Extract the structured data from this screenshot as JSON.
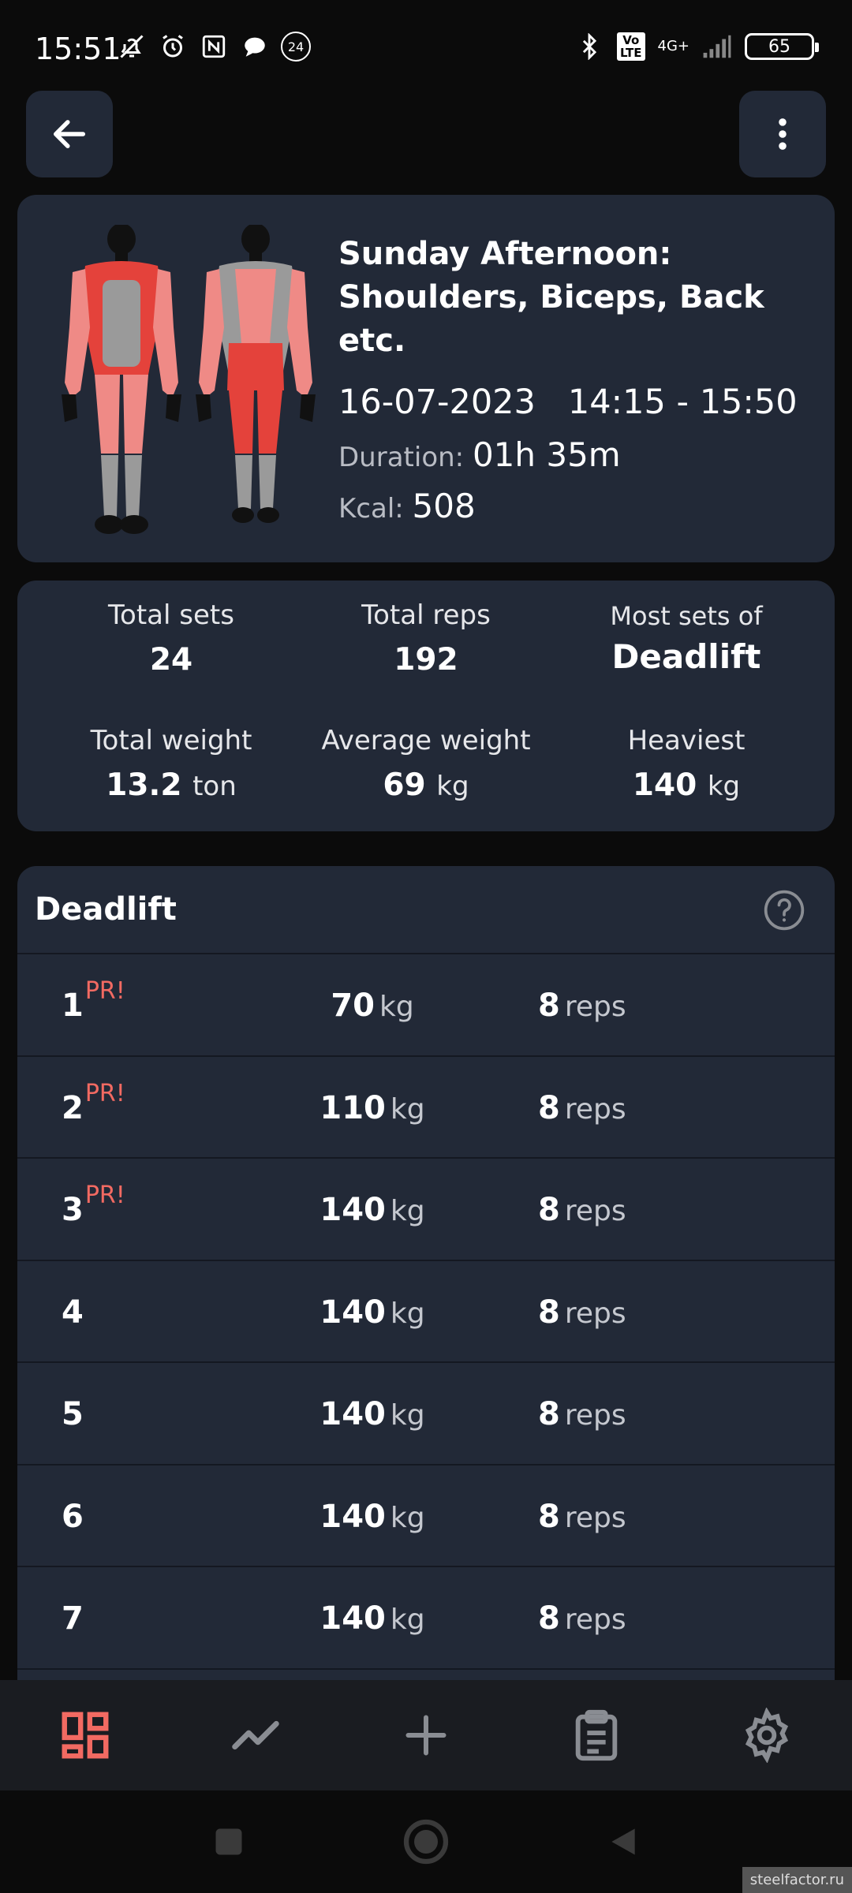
{
  "status_bar": {
    "time": "15:51",
    "notification_count": "24",
    "volte": "Vo\nLTE",
    "network": "4G+",
    "battery": "65"
  },
  "workout": {
    "title": "Sunday Afternoon: Shoulders, Biceps, Back etc.",
    "date": "16-07-2023",
    "time_range": "14:15 - 15:50",
    "duration_label": "Duration:",
    "duration_value": "01h 35m",
    "kcal_label": "Kcal:",
    "kcal_value": "508"
  },
  "stats": {
    "total_sets_label": "Total sets",
    "total_sets_value": "24",
    "total_reps_label": "Total reps",
    "total_reps_value": "192",
    "most_sets_label": "Most sets of",
    "most_sets_value": "Deadlift",
    "total_weight_label": "Total weight",
    "total_weight_value": "13.2",
    "total_weight_unit": "ton",
    "avg_weight_label": "Average weight",
    "avg_weight_value": "69",
    "avg_weight_unit": "kg",
    "heaviest_label": "Heaviest",
    "heaviest_value": "140",
    "heaviest_unit": "kg"
  },
  "exercise": {
    "name": "Deadlift",
    "pr_label": "PR!",
    "weight_unit": "kg",
    "reps_unit": "reps",
    "sets": [
      {
        "num": "1",
        "pr": "PR!",
        "weight": "70",
        "reps": "8"
      },
      {
        "num": "2",
        "pr": "PR!",
        "weight": "110",
        "reps": "8"
      },
      {
        "num": "3",
        "pr": "PR!",
        "weight": "140",
        "reps": "8"
      },
      {
        "num": "4",
        "pr": "",
        "weight": "140",
        "reps": "8"
      },
      {
        "num": "5",
        "pr": "",
        "weight": "140",
        "reps": "8"
      },
      {
        "num": "6",
        "pr": "",
        "weight": "140",
        "reps": "8"
      },
      {
        "num": "7",
        "pr": "",
        "weight": "140",
        "reps": "8"
      }
    ]
  },
  "nav": {
    "items": [
      "dashboard-icon",
      "chart-line-icon",
      "plus-icon",
      "clipboard-icon",
      "gear-icon"
    ],
    "active_color": "#f26a62",
    "inactive_color": "#8a8d93"
  },
  "colors": {
    "card": "#222937",
    "accent": "#f26a62"
  },
  "watermark": "steelfactor.ru"
}
